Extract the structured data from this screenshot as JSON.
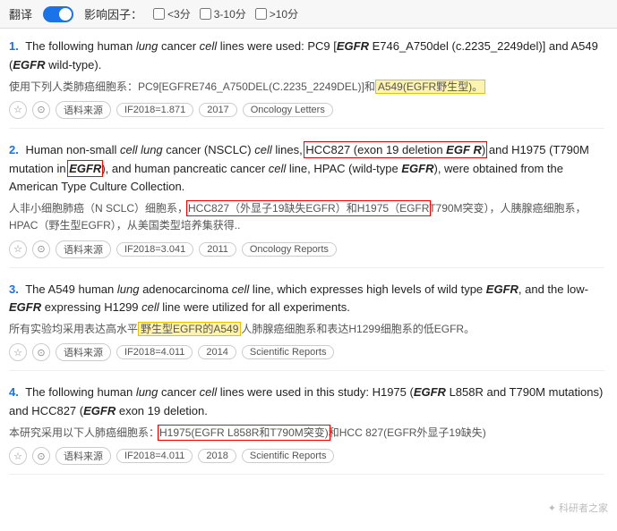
{
  "toolbar": {
    "translate_label": "翻译",
    "impact_label": "影响因子：",
    "filter1_label": "<3分",
    "filter2_label": "3-10分",
    "filter3_label": ">10分"
  },
  "results": [
    {
      "number": "1.",
      "en_text_parts": [
        {
          "text": "The following human ",
          "style": "normal"
        },
        {
          "text": "lung",
          "style": "italic"
        },
        {
          "text": " cancer ",
          "style": "normal"
        },
        {
          "text": "cell",
          "style": "italic"
        },
        {
          "text": " lines were used: PC9 [",
          "style": "normal"
        },
        {
          "text": "EGFR",
          "style": "bold-italic"
        },
        {
          "text": " E746_A750del (c.2235_2249del)] and A549 (",
          "style": "normal"
        },
        {
          "text": "EGFR",
          "style": "bold-italic"
        },
        {
          "text": " wild-type).",
          "style": "normal"
        }
      ],
      "cn_text_before_highlight": "使用下列人类肺癌细胞系：PC9[EGFRE746_A750DEL(C.2235_2249DEL)]和",
      "cn_highlight": "A549(EGFR野生型)。",
      "cn_highlight_style": "yellow",
      "cn_text_after": "",
      "star_filled": false,
      "meta": {
        "source_label": "语料来源",
        "if_label": "IF2018=1.871",
        "year_label": "2017",
        "journal_label": "Oncology Letters"
      }
    },
    {
      "number": "2.",
      "en_text_parts": [
        {
          "text": "Human non-small ",
          "style": "normal"
        },
        {
          "text": "cell lung",
          "style": "italic"
        },
        {
          "text": " cancer (NSCLC) ",
          "style": "normal"
        },
        {
          "text": "cell",
          "style": "italic"
        },
        {
          "text": " lines, ",
          "style": "normal"
        },
        {
          "text": "HCC827 (exon 19 deletion EGF R)",
          "style": "red-border"
        },
        {
          "text": " and H1975 (T790M mutation in ",
          "style": "normal"
        },
        {
          "text": "EGFR",
          "style": "bold-italic red-border-word"
        },
        {
          "text": "), and human pancreatic cancer ",
          "style": "normal"
        },
        {
          "text": "cell",
          "style": "italic"
        },
        {
          "text": " line, HPAC (wild-type ",
          "style": "normal"
        },
        {
          "text": "EGFR",
          "style": "bold-italic"
        },
        {
          "text": "), were obtained from the American Type Culture Collection.",
          "style": "normal"
        }
      ],
      "cn_text_before_highlight": "人非小细胞肺癌（N SCLC）细胞系，",
      "cn_highlight": "HCC827（外显子19缺失EGFR）和H1975（EGFR",
      "cn_highlight_style": "red-border",
      "cn_text_mid": "T790M突变），人胰腺癌细胞系，HPAC（野生型EGFR），从美国类型培养集获得..",
      "cn_text_after": "",
      "star_filled": false,
      "meta": {
        "source_label": "语料来源",
        "if_label": "IF2018=3.041",
        "year_label": "2011",
        "journal_label": "Oncology Reports"
      }
    },
    {
      "number": "3.",
      "en_text_parts": [
        {
          "text": "The A549 human ",
          "style": "normal"
        },
        {
          "text": "lung",
          "style": "italic"
        },
        {
          "text": " adenocarcinoma ",
          "style": "normal"
        },
        {
          "text": "cell",
          "style": "italic"
        },
        {
          "text": " line, which expresses high levels of wild type ",
          "style": "normal"
        },
        {
          "text": "EGFR",
          "style": "bold-italic"
        },
        {
          "text": ", and the low-",
          "style": "normal"
        },
        {
          "text": "EGFR",
          "style": "bold-italic"
        },
        {
          "text": " expressing H1299 ",
          "style": "normal"
        },
        {
          "text": "cell",
          "style": "italic"
        },
        {
          "text": " line were utilized for all experiments.",
          "style": "normal"
        }
      ],
      "cn_text_before_highlight": "所有实验均采用表达高水平",
      "cn_highlight": "野生型EGFR的A549",
      "cn_highlight_style": "yellow",
      "cn_text_after": "人肺腺癌细胞系和表达H1299细胞系的低EGFR。",
      "star_filled": false,
      "meta": {
        "source_label": "语料来源",
        "if_label": "IF2018=4.011",
        "year_label": "2014",
        "journal_label": "Scientific Reports"
      }
    },
    {
      "number": "4.",
      "en_text_parts": [
        {
          "text": "The following human ",
          "style": "normal"
        },
        {
          "text": "lung",
          "style": "italic"
        },
        {
          "text": " cancer ",
          "style": "normal"
        },
        {
          "text": "cell",
          "style": "italic"
        },
        {
          "text": " lines were used in this study: H1975 (",
          "style": "normal"
        },
        {
          "text": "EGFR",
          "style": "bold-italic"
        },
        {
          "text": " L858R and T790M mutations) and HCC827 (",
          "style": "normal"
        },
        {
          "text": "EGFR",
          "style": "bold-italic"
        },
        {
          "text": " exon 19 deletion.",
          "style": "normal"
        }
      ],
      "cn_text_before_highlight": "本研究采用以下人肺癌细胞系：",
      "cn_highlight": "H1975(EGFR L858R和T790M突变)",
      "cn_highlight_style": "red-border",
      "cn_text_after": "和HCC 827(EGFR外显子19缺失)",
      "star_filled": false,
      "meta": {
        "source_label": "语料来源",
        "if_label": "IF2018=4.011",
        "year_label": "2018",
        "journal_label": "Scientific Reports"
      }
    }
  ],
  "watermark": "科研者之家"
}
